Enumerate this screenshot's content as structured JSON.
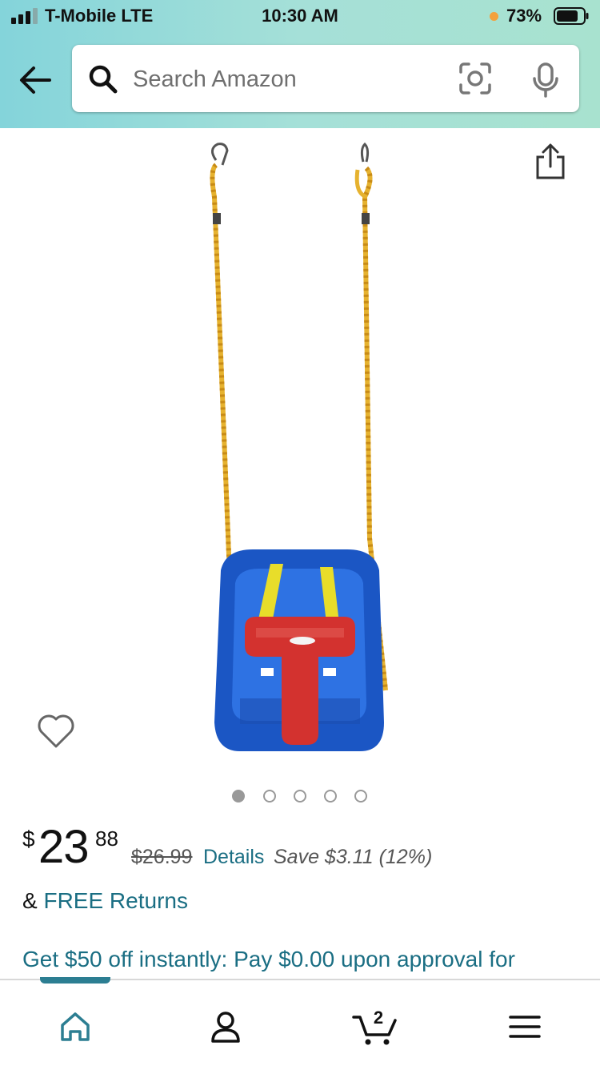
{
  "status_bar": {
    "carrier": "T-Mobile  LTE",
    "time": "10:30 AM",
    "battery_percent": "73%"
  },
  "search": {
    "placeholder": "Search Amazon"
  },
  "product": {
    "image_description": "Blue toddler swing with red T-bar and yellow ropes",
    "image_count": 5,
    "active_image_index": 0
  },
  "price": {
    "currency_symbol": "$",
    "whole": "23",
    "fraction": "88",
    "list_price": "$26.99",
    "details_label": "Details",
    "savings": "Save $3.11 (12%)"
  },
  "returns": {
    "prefix": "&",
    "label": "FREE Returns"
  },
  "promo": {
    "text": "Get $50 off instantly: Pay $0.00 upon approval for"
  },
  "nav": {
    "cart_count": "2",
    "active_tab": "home"
  },
  "colors": {
    "link": "#1a6e83",
    "header_gradient_start": "#84d4da",
    "header_gradient_end": "#a8e2cf",
    "nav_active": "#2c7e92"
  }
}
